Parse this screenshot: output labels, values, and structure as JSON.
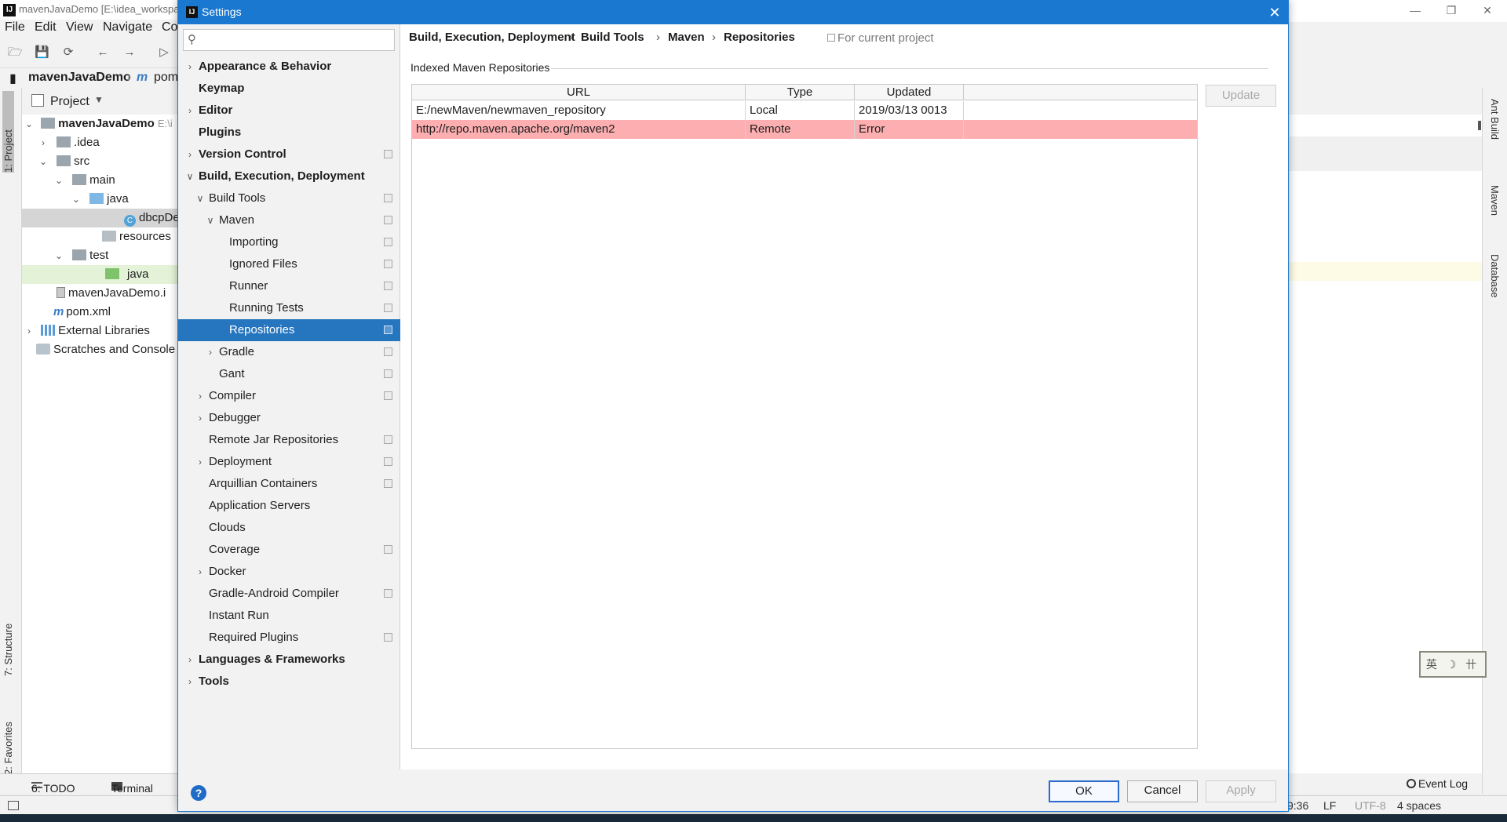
{
  "ide": {
    "window_title": "mavenJavaDemo [E:\\idea_workspac",
    "menu": [
      "File",
      "Edit",
      "View",
      "Navigate",
      "Co"
    ],
    "nav_project": "mavenJavaDemo",
    "nav_file": "pom",
    "project_view_label": "Project",
    "left_tabs": [
      "1: Project",
      "7: Structure",
      "2: Favorites"
    ],
    "right_tabs": [
      "Ant Build",
      "Maven",
      "Database"
    ],
    "tree": [
      {
        "label": "mavenJavaDemo",
        "suffix": "E:\\i"
      },
      {
        "label": ".idea"
      },
      {
        "label": "src"
      },
      {
        "label": "main"
      },
      {
        "label": "java"
      },
      {
        "label": "dbcpDe"
      },
      {
        "label": "resources"
      },
      {
        "label": "test"
      },
      {
        "label": "java"
      },
      {
        "label": "mavenJavaDemo.i"
      },
      {
        "label": "pom.xml"
      },
      {
        "label": "External Libraries"
      },
      {
        "label": "Scratches and Console"
      }
    ],
    "bottom_tabs": [
      "6: TODO",
      "Terminal"
    ],
    "event_log": "Event Log",
    "status": {
      "position": "9:36",
      "line_sep": "LF",
      "encoding": "UTF-8",
      "indent": "4 spaces"
    },
    "ime_text": "英 ☽ 卄"
  },
  "dialog": {
    "title": "Settings",
    "search_placeholder": "",
    "nav": [
      {
        "label": "Appearance & Behavior",
        "bold": true,
        "arrow": "›",
        "level": 0
      },
      {
        "label": "Keymap",
        "bold": true,
        "level": 0
      },
      {
        "label": "Editor",
        "bold": true,
        "arrow": "›",
        "level": 0
      },
      {
        "label": "Plugins",
        "bold": true,
        "level": 0
      },
      {
        "label": "Version Control",
        "bold": true,
        "arrow": "›",
        "level": 0,
        "project": true
      },
      {
        "label": "Build, Execution, Deployment",
        "bold": true,
        "arrow": "⌄",
        "level": 0
      },
      {
        "label": "Build Tools",
        "arrow": "⌄",
        "level": 1,
        "project": true
      },
      {
        "label": "Maven",
        "arrow": "⌄",
        "level": 2,
        "project": true
      },
      {
        "label": "Importing",
        "level": 3,
        "project": true
      },
      {
        "label": "Ignored Files",
        "level": 3,
        "project": true
      },
      {
        "label": "Runner",
        "level": 3,
        "project": true
      },
      {
        "label": "Running Tests",
        "level": 3,
        "project": true
      },
      {
        "label": "Repositories",
        "level": 3,
        "project": true,
        "selected": true
      },
      {
        "label": "Gradle",
        "arrow": "›",
        "level": 2,
        "project": true
      },
      {
        "label": "Gant",
        "level": 2,
        "project": true
      },
      {
        "label": "Compiler",
        "arrow": "›",
        "level": 1,
        "project": true
      },
      {
        "label": "Debugger",
        "arrow": "›",
        "level": 1
      },
      {
        "label": "Remote Jar Repositories",
        "level": 1,
        "project": true
      },
      {
        "label": "Deployment",
        "arrow": "›",
        "level": 1,
        "project": true
      },
      {
        "label": "Arquillian Containers",
        "level": 1,
        "project": true
      },
      {
        "label": "Application Servers",
        "level": 1
      },
      {
        "label": "Clouds",
        "level": 1
      },
      {
        "label": "Coverage",
        "level": 1,
        "project": true
      },
      {
        "label": "Docker",
        "arrow": "›",
        "level": 1
      },
      {
        "label": "Gradle-Android Compiler",
        "level": 1,
        "project": true
      },
      {
        "label": "Instant Run",
        "level": 1
      },
      {
        "label": "Required Plugins",
        "level": 1,
        "project": true
      },
      {
        "label": "Languages & Frameworks",
        "bold": true,
        "arrow": "›",
        "level": 0
      },
      {
        "label": "Tools",
        "bold": true,
        "arrow": "›",
        "level": 0
      }
    ],
    "breadcrumb": [
      "Build, Execution, Deployment",
      "Build Tools",
      "Maven",
      "Repositories"
    ],
    "scope_label": "For current project",
    "group_title": "Indexed Maven Repositories",
    "table": {
      "headers": [
        "URL",
        "Type",
        "Updated"
      ],
      "rows": [
        {
          "url": "E:/newMaven/newmaven_repository",
          "type": "Local",
          "updated": "2019/03/13 0013",
          "error": false
        },
        {
          "url": "http://repo.maven.apache.org/maven2",
          "type": "Remote",
          "updated": "Error",
          "error": true
        }
      ]
    },
    "update_label": "Update",
    "ok_label": "OK",
    "cancel_label": "Cancel",
    "apply_label": "Apply",
    "help_label": "?",
    "error_row_color": "#fcaeb0",
    "accent_color": "#2675bf"
  }
}
